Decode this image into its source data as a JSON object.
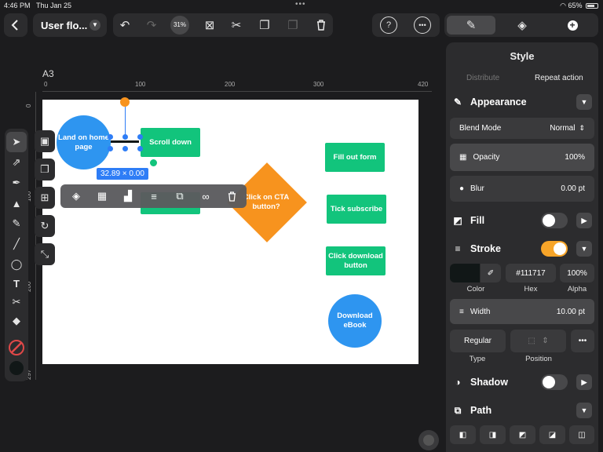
{
  "status": {
    "time": "4:46 PM",
    "date": "Thu Jan 25",
    "dots": "•••",
    "battery": "65%"
  },
  "document": {
    "title": "User flo...",
    "zoom": "31%"
  },
  "artboard": {
    "name": "A3"
  },
  "ruler": {
    "h_ticks": [
      "0",
      "100",
      "200",
      "300",
      "420"
    ],
    "v_ticks": [
      "0",
      "100",
      "200",
      "297"
    ]
  },
  "canvas": {
    "nodes": {
      "land": "Land on home page",
      "scroll": "Scroll down",
      "cta": "Click on CTA button?",
      "fill_form": "Fill out form",
      "tick": "Tick subscribe",
      "click_download": "Click download button",
      "download": "Download eBook"
    },
    "selection_dims": "32.89 × 0.00"
  },
  "panel": {
    "header": "Style",
    "seg_left": "Distribute",
    "seg_right": "Repeat action",
    "appearance": {
      "title": "Appearance",
      "blend_label": "Blend Mode",
      "blend_value": "Normal",
      "opacity_label": "Opacity",
      "opacity_value": "100%",
      "blur_label": "Blur",
      "blur_value": "0.00 pt"
    },
    "fill": {
      "title": "Fill",
      "enabled": false
    },
    "stroke": {
      "title": "Stroke",
      "enabled": true,
      "hex": "#111717",
      "alpha": "100%",
      "color_label": "Color",
      "hex_label": "Hex",
      "alpha_label": "Alpha",
      "width_label": "Width",
      "width_value": "10.00 pt",
      "type_value": "Regular",
      "type_label": "Type",
      "position_label": "Position",
      "swatch_color": "#111717",
      "toggle_color": "#f7a529"
    },
    "shadow": {
      "title": "Shadow",
      "enabled": false
    },
    "path": {
      "title": "Path"
    }
  },
  "colors": {
    "green": "#12c47c",
    "blue": "#2e95f0",
    "orange": "#f7931e",
    "selection": "#2e7df6"
  }
}
